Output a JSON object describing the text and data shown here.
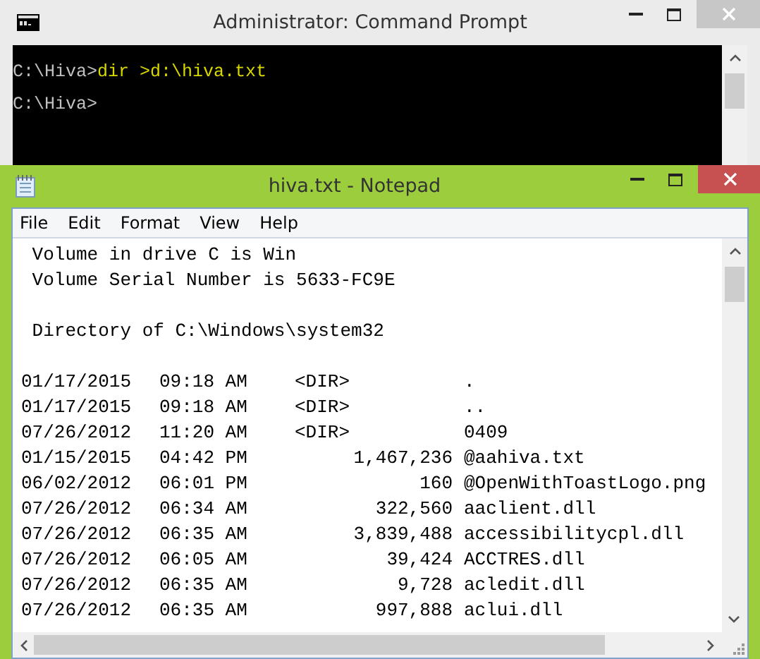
{
  "cmd_window": {
    "title": "Administrator: Command Prompt",
    "active": false,
    "lines": [
      {
        "prompt": "C:\\Hiva>",
        "command": "dir >d:\\hiva.txt"
      },
      {
        "prompt": "C:\\Hiva>"
      }
    ]
  },
  "notepad_window": {
    "title": "hiva.txt - Notepad",
    "active": true,
    "menu": [
      "File",
      "Edit",
      "Format",
      "View",
      "Help"
    ],
    "header_paragraphs": [
      [
        " Volume in drive C is Win",
        " Volume Serial Number is 5633-FC9E"
      ],
      [
        " Directory of C:\\Windows\\system32"
      ]
    ],
    "entries": [
      {
        "date": "01/17/2015",
        "time": "09:18 AM",
        "kind": "dir",
        "marker": "<DIR>",
        "name": "."
      },
      {
        "date": "01/17/2015",
        "time": "09:18 AM",
        "kind": "dir",
        "marker": "<DIR>",
        "name": ".."
      },
      {
        "date": "07/26/2012",
        "time": "11:20 AM",
        "kind": "dir",
        "marker": "<DIR>",
        "name": "0409"
      },
      {
        "date": "01/15/2015",
        "time": "04:42 PM",
        "kind": "file",
        "size": "1,467,236",
        "name": "@aahiva.txt"
      },
      {
        "date": "06/02/2012",
        "time": "06:01 PM",
        "kind": "file",
        "size": "160",
        "name": "@OpenWithToastLogo.png"
      },
      {
        "date": "07/26/2012",
        "time": "06:34 AM",
        "kind": "file",
        "size": "322,560",
        "name": "aaclient.dll"
      },
      {
        "date": "07/26/2012",
        "time": "06:35 AM",
        "kind": "file",
        "size": "3,839,488",
        "name": "accessibilitycpl.dll"
      },
      {
        "date": "07/26/2012",
        "time": "06:05 AM",
        "kind": "file",
        "size": "39,424",
        "name": "ACCTRES.dll"
      },
      {
        "date": "07/26/2012",
        "time": "06:35 AM",
        "kind": "file",
        "size": "9,728",
        "name": "acledit.dll"
      },
      {
        "date": "07/26/2012",
        "time": "06:35 AM",
        "kind": "file",
        "size": "997,888",
        "name": "aclui.dll"
      }
    ]
  }
}
